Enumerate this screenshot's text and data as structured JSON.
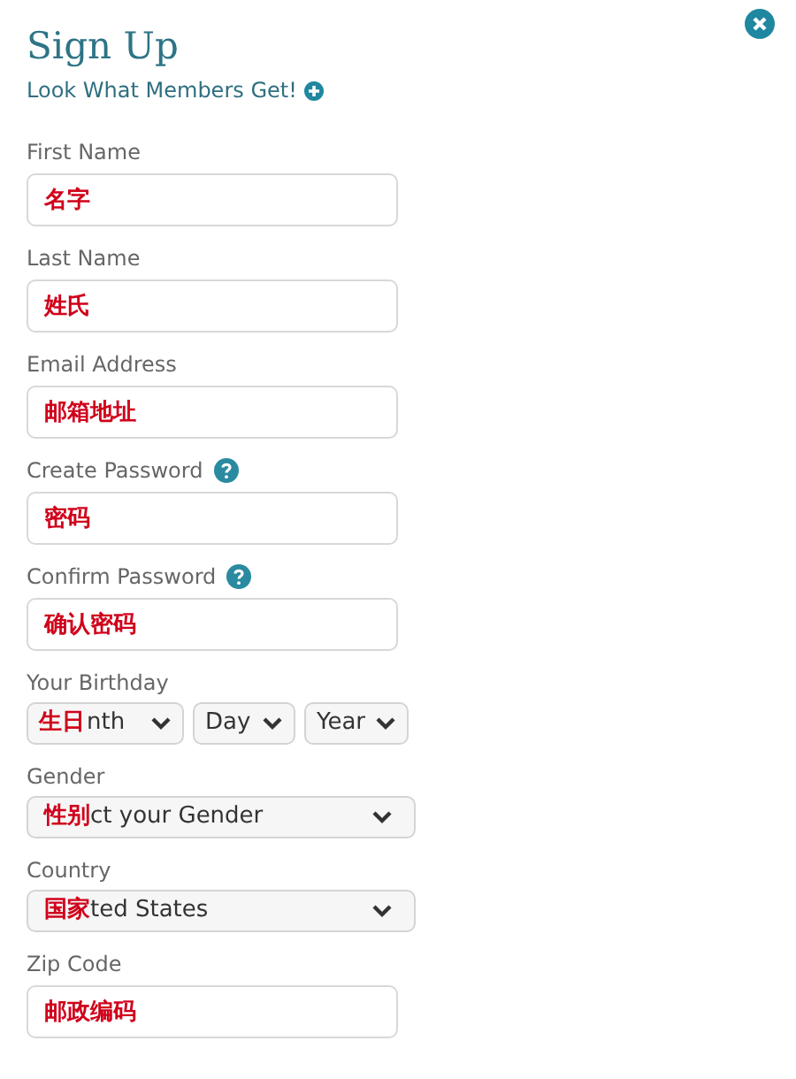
{
  "title": "Sign Up",
  "members_link": "Look What Members Get!",
  "fields": [
    {
      "kind": "text",
      "label": "First Name",
      "annotation": "名字"
    },
    {
      "kind": "text",
      "label": "Last Name",
      "annotation": "姓氏"
    },
    {
      "kind": "text",
      "label": "Email Address",
      "annotation": "邮箱地址"
    },
    {
      "kind": "text",
      "label": "Create Password",
      "annotation": "密码",
      "help": true
    },
    {
      "kind": "text",
      "label": "Confirm Password",
      "annotation": "确认密码",
      "help": true
    },
    {
      "kind": "birthday",
      "label": "Your Birthday",
      "annotation": "生日",
      "selects": [
        "nth",
        "Day",
        "Year"
      ]
    },
    {
      "kind": "select",
      "label": "Gender",
      "annotation": "性别",
      "value": "ct your Gender"
    },
    {
      "kind": "select",
      "label": "Country",
      "annotation": "国家",
      "value": "ted States"
    },
    {
      "kind": "text",
      "label": "Zip Code",
      "annotation": "邮政编码"
    }
  ]
}
